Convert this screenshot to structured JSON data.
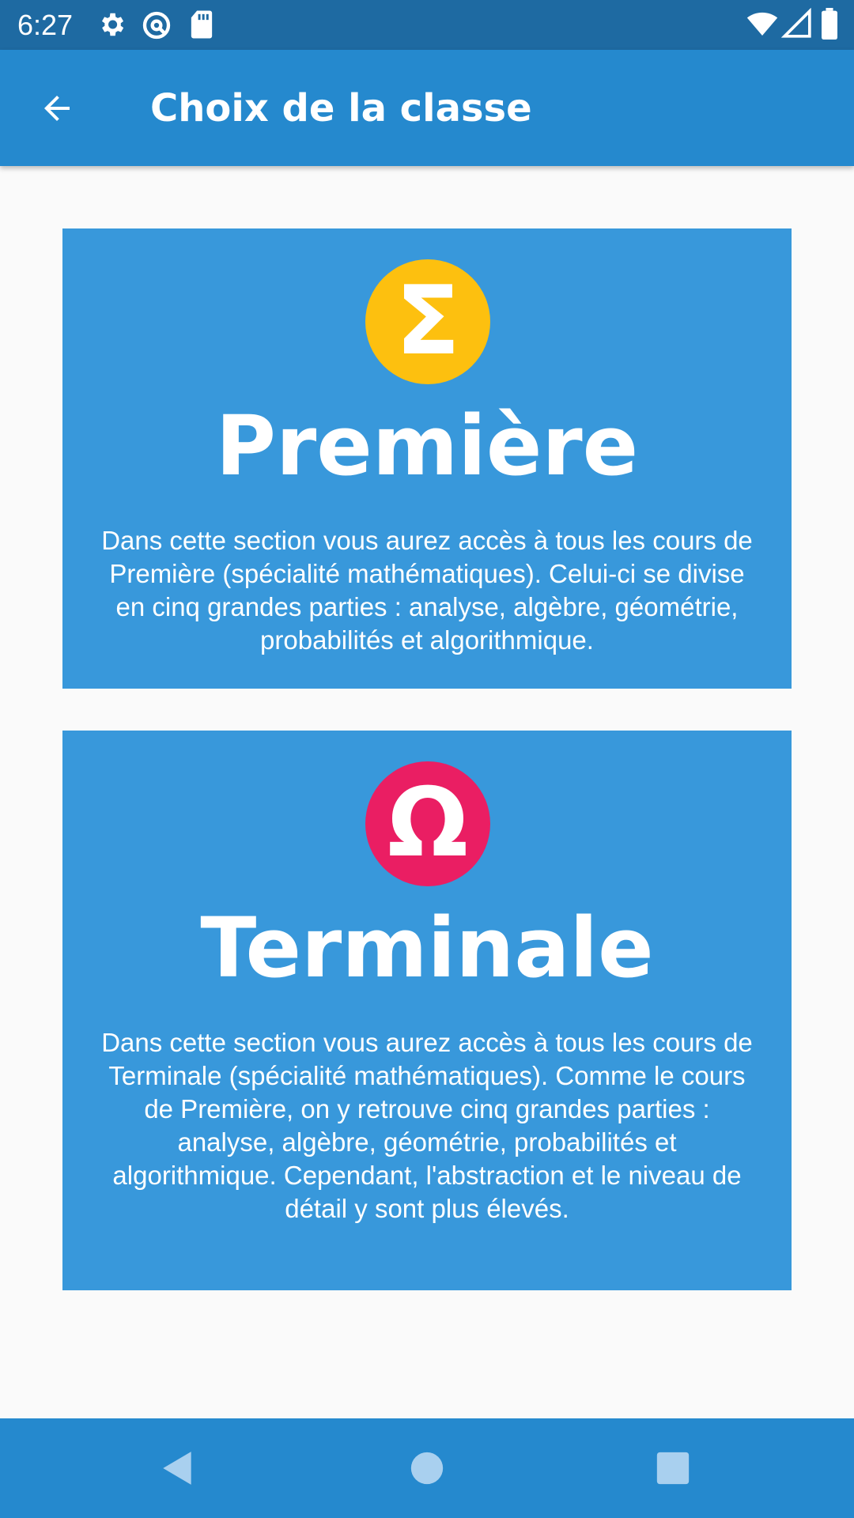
{
  "status_bar": {
    "time": "6:27",
    "icons": [
      "settings-icon",
      "at-sign-icon",
      "sd-card-icon",
      "wifi-icon",
      "signal-icon",
      "battery-icon"
    ]
  },
  "app_bar": {
    "title": "Choix de la classe",
    "back_icon": "arrow-left-icon"
  },
  "cards": [
    {
      "symbol": "Σ",
      "badge_color": "#fdc00f",
      "title": "Première",
      "description": "Dans cette section vous aurez accès à tous les cours de Première (spécialité mathématiques). Celui-ci se divise en cinq grandes parties : analyse, algèbre, géométrie, probabilités et algorithmique."
    },
    {
      "symbol": "Ω",
      "badge_color": "#ea1e63",
      "title": "Terminale",
      "description": "Dans cette section vous aurez accès à tous les cours de Terminale (spécialité mathématiques). Comme le cours de Première, on y retrouve cinq grandes parties : analyse, algèbre, géométrie, probabilités et algorithmique. Cependant, l'abstraction et le niveau de détail y sont plus élevés."
    }
  ],
  "nav_bar": {
    "buttons": [
      "back-triangle-icon",
      "home-circle-icon",
      "recents-square-icon"
    ]
  },
  "colors": {
    "status_bar": "#1e6aa2",
    "app_bar": "#2589ce",
    "card": "#3898db",
    "background": "#fafafa"
  }
}
